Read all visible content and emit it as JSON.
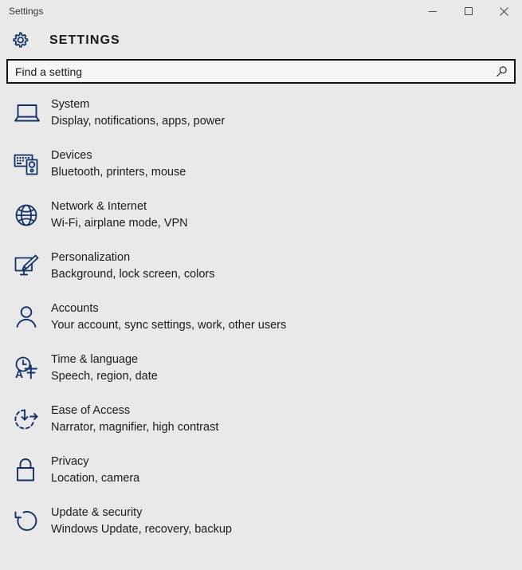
{
  "window": {
    "title": "Settings",
    "caption_buttons": [
      {
        "name": "minimize",
        "label": "Minimize"
      },
      {
        "name": "maximize",
        "label": "Maximize"
      },
      {
        "name": "close",
        "label": "Close"
      }
    ]
  },
  "header": {
    "icon": "gear-icon",
    "title": "SETTINGS"
  },
  "search": {
    "placeholder": "Find a setting",
    "value": "",
    "icon": "search-icon"
  },
  "colors": {
    "background": "#e9e9e9",
    "icon_accent": "#12306b",
    "text": "#1b1b1b",
    "search_background": "#f6f6f6",
    "search_border": "#111111"
  },
  "settings": [
    {
      "icon": "laptop-icon",
      "title": "System",
      "description": "Display, notifications, apps, power"
    },
    {
      "icon": "devices-icon",
      "title": "Devices",
      "description": "Bluetooth, printers, mouse"
    },
    {
      "icon": "globe-icon",
      "title": "Network & Internet",
      "description": "Wi-Fi, airplane mode, VPN"
    },
    {
      "icon": "paintbrush-monitor-icon",
      "title": "Personalization",
      "description": "Background, lock screen, colors"
    },
    {
      "icon": "person-icon",
      "title": "Accounts",
      "description": "Your account, sync settings, work, other users"
    },
    {
      "icon": "clock-language-icon",
      "title": "Time & language",
      "description": "Speech, region, date"
    },
    {
      "icon": "ease-of-access-icon",
      "title": "Ease of Access",
      "description": "Narrator, magnifier, high contrast"
    },
    {
      "icon": "lock-icon",
      "title": "Privacy",
      "description": "Location, camera"
    },
    {
      "icon": "refresh-icon",
      "title": "Update & security",
      "description": "Windows Update, recovery, backup"
    }
  ]
}
